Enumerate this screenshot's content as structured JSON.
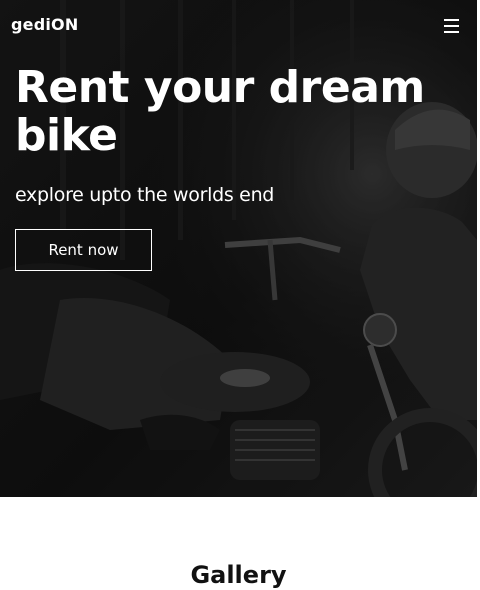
{
  "navbar": {
    "brand": "gediON",
    "menu_icon": "hamburger-menu-icon"
  },
  "hero": {
    "headline": "Rent your dream bike",
    "tagline": "explore upto the worlds end",
    "cta_label": "Rent now",
    "background_image": "monochrome photo of riders on a motorcycle"
  },
  "gallery": {
    "heading": "Gallery"
  },
  "colors": {
    "hero_text": "#ffffff",
    "hero_overlay": "#141414",
    "page_background": "#ffffff",
    "heading_text": "#111111"
  }
}
